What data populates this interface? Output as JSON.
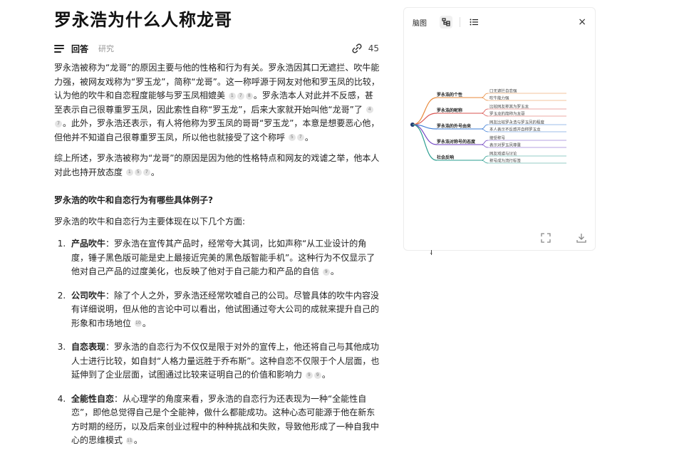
{
  "title": "罗永浩为什么人称龙哥",
  "tabs": {
    "answer": "回答",
    "research": "研究"
  },
  "share_count": "45",
  "paragraphs": {
    "p1": "罗永浩被称为“龙哥”的原因主要与他的性格和行为有关。罗永浩因其口无遮拦、吹牛能力强，被网友戏称为“罗玉龙”，简称“龙哥”。这一称呼源于网友对他和罗玉凤的比较，认为他的吹牛和自恋程度能够与罗玉凤相媲美",
    "p1b": "。罗永浩本人对此并不反感，甚至表示自己很尊重罗玉凤，因此索性自称“罗玉龙”，后来大家就开始叫他“龙哥”了",
    "p1c": "。此外，罗永浩还表示，有人将他称为罗玉凤的哥哥“罗玉龙”，本意是想要恶心他，但他并不知道自己很尊重罗玉凤，所以他也就接受了这个称呼",
    "p2": "综上所述，罗永浩被称为“龙哥”的原因是因为他的性格特点和网友的戏谑之举，他本人对此也持开放态度",
    "p2end": "。"
  },
  "section_heading": "罗永浩的吹牛和自恋行为有哪些具体例子?",
  "intro": "罗永浩的吹牛和自恋行为主要体现在以下几个方面:",
  "punct": "。",
  "list": [
    {
      "label": "产品吹牛",
      "text": "：罗永浩在宣传其产品时，经常夸大其词，比如声称“从工业设计的角度，锤子黑色版可能是史上最接近完美的黑色版智能手机”。这种行为不仅显示了他对自己产品的过度美化，也反映了他对于自己能力和产品的自信"
    },
    {
      "label": "公司吹牛",
      "text": "：除了个人之外，罗永浩还经常吹嘘自己的公司。尽管具体的吹牛内容没有详细说明，但从他的言论中可以看出，他试图通过夸大公司的成就来提升自己的形象和市场地位"
    },
    {
      "label": "自恋表现",
      "text": "：罗永浩的自恋行为不仅仅是限于对外的宣传上，他还将自己与其他成功人士进行比较，如自封“人格力量远胜于乔布斯”。这种自恋不仅限于个人层面，也延伸到了企业层面，试图通过比较来证明自己的价值和影响力"
    },
    {
      "label": "全能性自恋",
      "text": "：从心理学的角度来看，罗永浩的自恋行为还表现为一种“全能性自恋”，即他总觉得自己是个全能神，做什么都能成功。这种心态可能源于他在新东方时期的经历，以及后来创业过程中的种种挑战和失败，导致他形成了一种自我中心的思维模式"
    }
  ],
  "cites": {
    "a": "1",
    "b": "4",
    "c": "5",
    "d": "7",
    "e": "8",
    "f": "9",
    "g": "10",
    "h": "11"
  },
  "panel": {
    "label": "脑图",
    "close": "×",
    "branches": [
      {
        "name": "罗永浩的个性",
        "leaves": [
          "口无遮拦自恋强",
          "吹牛能力强"
        ]
      },
      {
        "name": "罗永浩的昵称",
        "leaves": [
          "比较网友称其为罗玉龙",
          "罗玉龙的简称为龙哥"
        ]
      },
      {
        "name": "罗永浩的外号由来",
        "leaves": [
          "网友比较罗永浩与罗玉凤的程度",
          "本人表示不反感并自称罗玉龙"
        ]
      },
      {
        "name": "罗永浩对称号的态度",
        "leaves": [
          "接受称号",
          "表示对罗玉凤尊重"
        ]
      },
      {
        "name": "社会反响",
        "leaves": [
          "网友戏谑与讨论",
          "称号成为流行标签"
        ]
      }
    ]
  },
  "colors": {
    "b0": "#e8893a",
    "b1": "#d9534f",
    "b2": "#3a7bd5",
    "b3": "#6f42c1",
    "b4": "#2a9d8f",
    "root": "#1f3b73"
  }
}
